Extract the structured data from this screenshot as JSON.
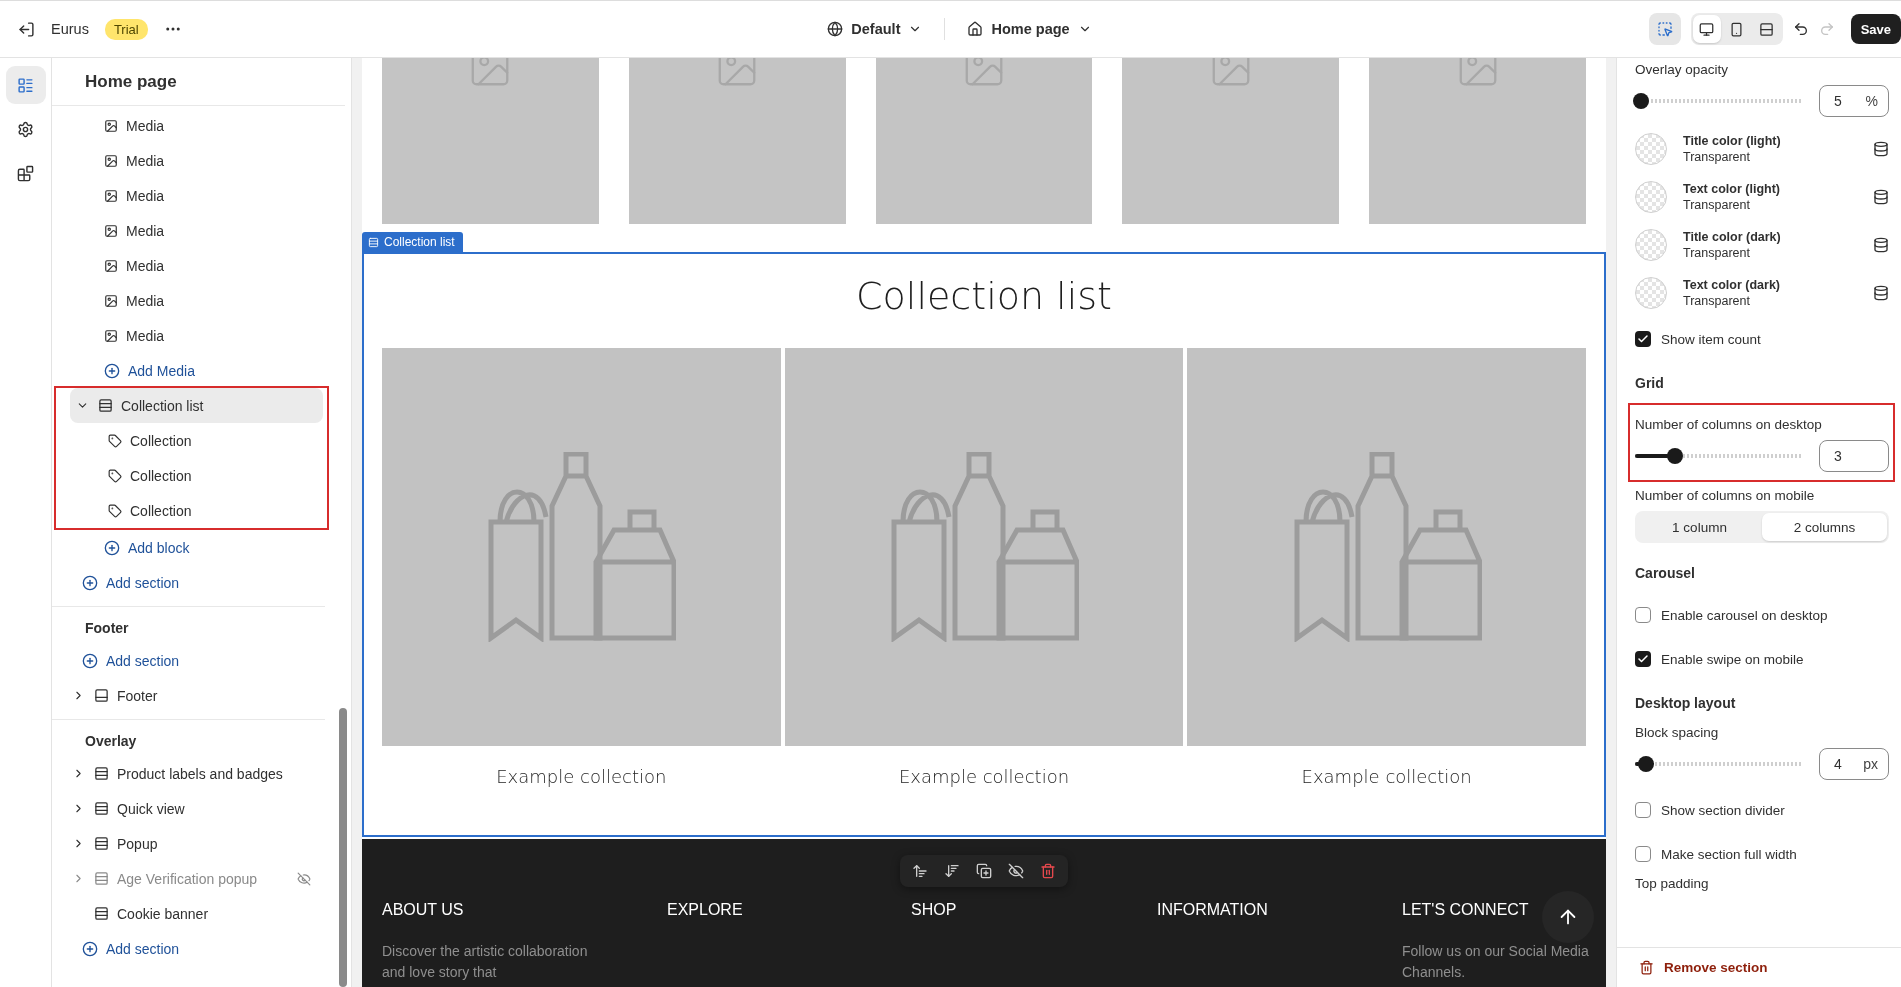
{
  "topbar": {
    "store_name": "Eurus",
    "badge": "Trial",
    "theme": "Default",
    "page": "Home page",
    "save": "Save",
    "tools": [
      {
        "kind": "inspector",
        "selected": true
      }
    ],
    "devices": [
      {
        "kind": "desktop",
        "selected": true
      },
      {
        "kind": "mobile",
        "selected": false
      },
      {
        "kind": "fullwidth",
        "selected": false
      }
    ],
    "undo": {
      "disabled": false
    },
    "redo": {
      "disabled": true
    }
  },
  "rail": [
    {
      "kind": "sections",
      "selected": true
    },
    {
      "kind": "settings",
      "selected": false
    },
    {
      "kind": "apps",
      "selected": false
    }
  ],
  "sidebar": {
    "title": "Home page",
    "groups": [
      {
        "items": [
          {
            "kind": "blocks",
            "children": [
              {
                "kind": "media",
                "label": "Media"
              },
              {
                "kind": "media",
                "label": "Media"
              },
              {
                "kind": "media",
                "label": "Media"
              },
              {
                "kind": "media",
                "label": "Media"
              },
              {
                "kind": "media",
                "label": "Media"
              },
              {
                "kind": "media",
                "label": "Media"
              },
              {
                "kind": "media",
                "label": "Media"
              },
              {
                "kind": "add",
                "label": "Add Media"
              }
            ]
          },
          {
            "kind": "section",
            "label": "Collection list",
            "expandable": true,
            "expanded": true,
            "selected": true,
            "hidden": false,
            "highlighted": true,
            "children": [
              {
                "kind": "collection",
                "label": "Collection"
              },
              {
                "kind": "collection",
                "label": "Collection"
              },
              {
                "kind": "collection",
                "label": "Collection"
              }
            ]
          },
          {
            "kind": "add_block",
            "label": "Add block"
          },
          {
            "kind": "add",
            "label": "Add section"
          }
        ]
      },
      {
        "title": "Footer",
        "items": [
          {
            "kind": "add",
            "label": "Add section"
          },
          {
            "kind": "footer",
            "label": "Footer",
            "expandable": true,
            "expanded": false,
            "selected": false,
            "hidden": false,
            "highlighted": false
          }
        ]
      },
      {
        "title": "Overlay",
        "items": [
          {
            "kind": "section",
            "label": "Product labels and badges",
            "expandable": true,
            "expanded": false,
            "selected": false,
            "hidden": false,
            "highlighted": false
          },
          {
            "kind": "section",
            "label": "Quick view",
            "expandable": true,
            "expanded": false,
            "selected": false,
            "hidden": false,
            "highlighted": false
          },
          {
            "kind": "section",
            "label": "Popup",
            "expandable": true,
            "expanded": false,
            "selected": false,
            "hidden": false,
            "highlighted": false
          },
          {
            "kind": "section",
            "label": "Age Verification popup",
            "expandable": true,
            "expanded": false,
            "selected": false,
            "hidden": true,
            "highlighted": false
          },
          {
            "kind": "section",
            "label": "Cookie banner",
            "expandable": false,
            "selected": false,
            "hidden": false,
            "highlighted": false
          },
          {
            "kind": "add",
            "label": "Add section"
          }
        ]
      }
    ]
  },
  "preview": {
    "media_row": [
      {
        "kind": "placeholder"
      },
      {
        "kind": "placeholder"
      },
      {
        "kind": "placeholder"
      },
      {
        "kind": "placeholder"
      },
      {
        "kind": "placeholder"
      }
    ],
    "section": {
      "tag": "Collection list",
      "selected": true,
      "title": "Collection list",
      "collections": [
        {
          "title": "Example collection"
        },
        {
          "title": "Example collection"
        },
        {
          "title": "Example collection"
        }
      ]
    },
    "section_toolbar": [
      {
        "kind": "move_up"
      },
      {
        "kind": "move_down"
      },
      {
        "kind": "duplicate"
      },
      {
        "kind": "hide"
      },
      {
        "kind": "delete"
      }
    ],
    "footer": {
      "columns": [
        {
          "title": "ABOUT US",
          "text": "Discover the artistic collaboration and love story that"
        },
        {
          "title": "EXPLORE"
        },
        {
          "title": "SHOP"
        },
        {
          "title": "INFORMATION"
        },
        {
          "title": "LET'S CONNECT",
          "text": "Follow us on our Social Media Channels."
        }
      ]
    }
  },
  "settings": {
    "items": [
      {
        "kind": "range",
        "label": "Overlay opacity",
        "level": 0,
        "value": "5",
        "unit": "%"
      },
      {
        "kind": "color",
        "label": "Title color (light)",
        "value": "Transparent"
      },
      {
        "kind": "color",
        "label": "Text color (light)",
        "value": "Transparent"
      },
      {
        "kind": "color",
        "label": "Title color (dark)",
        "value": "Transparent"
      },
      {
        "kind": "color",
        "label": "Text color (dark)",
        "value": "Transparent"
      },
      {
        "kind": "checkbox",
        "label": "Show item count",
        "checked": true
      },
      {
        "kind": "heading",
        "label": "Grid"
      },
      {
        "kind": "range",
        "label": "Number of columns on desktop",
        "level": 0.2,
        "value": "3",
        "highlighted": true
      },
      {
        "kind": "segmented",
        "label": "Number of columns on mobile",
        "options": [
          {
            "label": "1 column",
            "selected": false
          },
          {
            "label": "2 columns",
            "selected": true
          }
        ]
      },
      {
        "kind": "heading",
        "label": "Carousel"
      },
      {
        "kind": "checkbox",
        "label": "Enable carousel on desktop",
        "checked": false
      },
      {
        "kind": "checkbox",
        "label": "Enable swipe on mobile",
        "checked": true
      },
      {
        "kind": "heading",
        "label": "Desktop layout"
      },
      {
        "kind": "range",
        "label": "Block spacing",
        "level": 0.03,
        "value": "4",
        "unit": "px"
      },
      {
        "kind": "checkbox",
        "label": "Show section divider",
        "checked": false
      },
      {
        "kind": "checkbox",
        "label": "Make section full width",
        "checked": false
      },
      {
        "kind": "label",
        "label": "Top padding"
      }
    ],
    "remove": "Remove section"
  }
}
